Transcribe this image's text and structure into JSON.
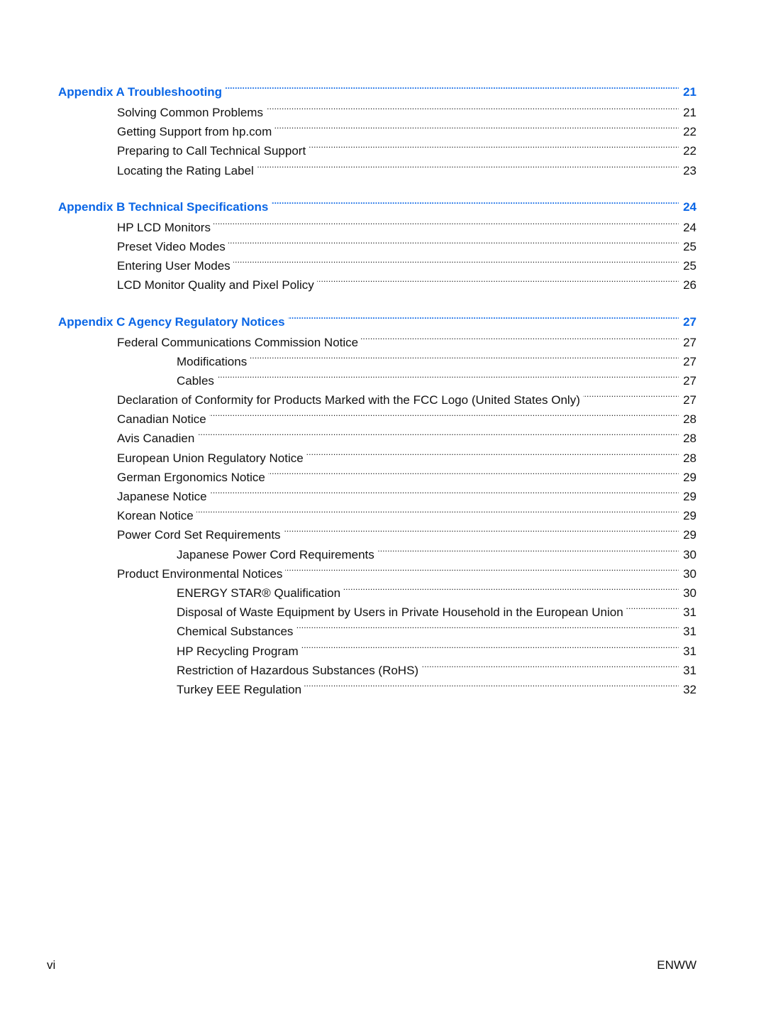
{
  "toc": {
    "sections": [
      {
        "heading": {
          "label": "Appendix A  Troubleshooting",
          "page": "21"
        },
        "entries": [
          {
            "level": 1,
            "label": "Solving Common Problems",
            "page": "21"
          },
          {
            "level": 1,
            "label": "Getting Support from hp.com",
            "page": "22"
          },
          {
            "level": 1,
            "label": "Preparing to Call Technical Support",
            "page": "22"
          },
          {
            "level": 1,
            "label": "Locating the Rating Label",
            "page": "23"
          }
        ]
      },
      {
        "heading": {
          "label": "Appendix B  Technical Specifications",
          "page": "24"
        },
        "entries": [
          {
            "level": 1,
            "label": "HP LCD Monitors",
            "page": "24"
          },
          {
            "level": 1,
            "label": "Preset Video Modes",
            "page": "25"
          },
          {
            "level": 1,
            "label": "Entering User Modes",
            "page": "25"
          },
          {
            "level": 1,
            "label": "LCD Monitor Quality and Pixel Policy",
            "page": "26"
          }
        ]
      },
      {
        "heading": {
          "label": "Appendix C  Agency Regulatory Notices",
          "page": "27"
        },
        "entries": [
          {
            "level": 1,
            "label": "Federal Communications Commission Notice",
            "page": "27"
          },
          {
            "level": 2,
            "label": "Modifications",
            "page": "27"
          },
          {
            "level": 2,
            "label": "Cables",
            "page": "27"
          },
          {
            "level": 1,
            "label": "Declaration of Conformity for Products Marked with the FCC Logo (United States Only)",
            "page": "27"
          },
          {
            "level": 1,
            "label": "Canadian Notice",
            "page": "28"
          },
          {
            "level": 1,
            "label": "Avis Canadien",
            "page": "28"
          },
          {
            "level": 1,
            "label": "European Union Regulatory Notice",
            "page": "28"
          },
          {
            "level": 1,
            "label": "German Ergonomics Notice",
            "page": "29"
          },
          {
            "level": 1,
            "label": "Japanese Notice",
            "page": "29"
          },
          {
            "level": 1,
            "label": "Korean Notice",
            "page": "29"
          },
          {
            "level": 1,
            "label": "Power Cord Set Requirements",
            "page": "29"
          },
          {
            "level": 2,
            "label": "Japanese Power Cord Requirements",
            "page": "30"
          },
          {
            "level": 1,
            "label": "Product Environmental Notices",
            "page": "30"
          },
          {
            "level": 2,
            "label": "ENERGY STAR® Qualification",
            "page": "30"
          },
          {
            "level": 2,
            "label": "Disposal of Waste Equipment by Users in Private Household in the European Union",
            "page": "31"
          },
          {
            "level": 2,
            "label": "Chemical Substances",
            "page": "31"
          },
          {
            "level": 2,
            "label": "HP Recycling Program",
            "page": "31"
          },
          {
            "level": 2,
            "label": "Restriction of Hazardous Substances (RoHS)",
            "page": "31"
          },
          {
            "level": 2,
            "label": "Turkey EEE Regulation",
            "page": "32"
          }
        ]
      }
    ]
  },
  "footer": {
    "page_number": "vi",
    "doc_code": "ENWW"
  },
  "colors": {
    "heading": "#0a66e6",
    "text": "#111111"
  }
}
